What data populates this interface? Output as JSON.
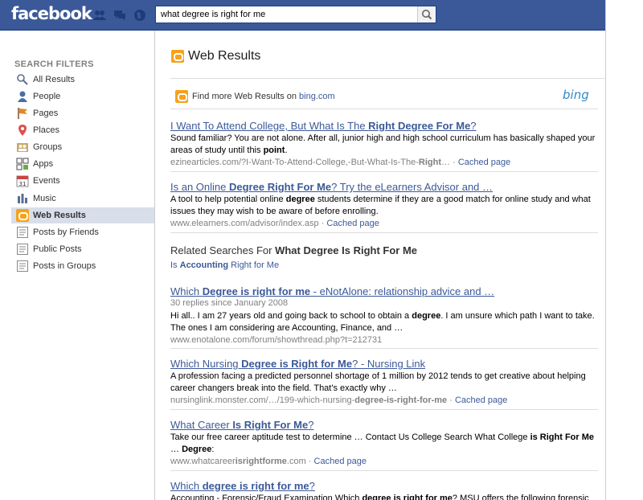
{
  "header": {
    "logo": "facebook",
    "search_value": "what degree is right for me"
  },
  "sidebar": {
    "title": "SEARCH FILTERS",
    "items": [
      {
        "label": "All Results",
        "icon": "magnifier-icon"
      },
      {
        "label": "People",
        "icon": "person-icon"
      },
      {
        "label": "Pages",
        "icon": "flag-icon"
      },
      {
        "label": "Places",
        "icon": "map-pin-icon"
      },
      {
        "label": "Groups",
        "icon": "groups-icon"
      },
      {
        "label": "Apps",
        "icon": "puzzle-icon"
      },
      {
        "label": "Events",
        "icon": "calendar-icon"
      },
      {
        "label": "Music",
        "icon": "music-icon"
      },
      {
        "label": "Web Results",
        "icon": "bing-icon",
        "active": true
      },
      {
        "label": "Posts by Friends",
        "icon": "posts-icon"
      },
      {
        "label": "Public Posts",
        "icon": "posts-icon"
      },
      {
        "label": "Posts in Groups",
        "icon": "posts-icon"
      }
    ]
  },
  "main": {
    "heading": "Web Results",
    "find_more_prefix": "Find more Web Results on",
    "find_more_link": "bing.com",
    "bing_logo": "bing",
    "cached_label": "Cached page",
    "related_prefix": "Related Searches For",
    "related_query": "What Degree Is Right For Me",
    "related_items": [
      {
        "pre": "Is ",
        "bold": "Accounting",
        "post": " Right for Me"
      }
    ]
  },
  "results": [
    {
      "title_parts": [
        [
          "I Want To Attend College, But What Is The ",
          false
        ],
        [
          "Right Degree For Me",
          true
        ],
        [
          "?",
          false
        ]
      ],
      "meta": "",
      "snippet_parts": [
        [
          "Sound familiar? You are not alone. After all, junior high and high school curriculum has basically shaped your areas of study until this ",
          false
        ],
        [
          "point",
          true
        ],
        [
          ".",
          false
        ]
      ],
      "url_parts": [
        [
          "ezinearticles.com/?I-Want-To-Attend-College,-But-What-Is-The-",
          false
        ],
        [
          "Right",
          true
        ],
        [
          "…",
          false
        ]
      ],
      "cached": true
    },
    {
      "title_parts": [
        [
          "Is an Online ",
          false
        ],
        [
          "Degree Right For Me",
          true
        ],
        [
          "? Try the eLearners Advisor and …",
          false
        ]
      ],
      "meta": "",
      "snippet_parts": [
        [
          "A tool to help potential online ",
          false
        ],
        [
          "degree",
          true
        ],
        [
          " students determine if they are a good match for online study and what issues they may wish to be aware of before enrolling.",
          false
        ]
      ],
      "url_parts": [
        [
          "www.elearners.com/advisor/index.asp",
          false
        ]
      ],
      "cached": true
    },
    {
      "title_parts": [
        [
          "Which ",
          false
        ],
        [
          "Degree is right for me",
          true
        ],
        [
          " - eNotAlone: relationship advice and …",
          false
        ]
      ],
      "meta": "30 replies since January 2008",
      "snippet_parts": [
        [
          "Hi all.. I am 27 years old and going back to school to obtain a ",
          false
        ],
        [
          "degree",
          true
        ],
        [
          ". I am unsure which path I want to take. The ones I am considering are Accounting, Finance, and …",
          false
        ]
      ],
      "url_parts": [
        [
          "www.enotalone.com/forum/showthread.php?t=212731",
          false
        ]
      ],
      "cached": false
    },
    {
      "title_parts": [
        [
          "Which Nursing ",
          false
        ],
        [
          "Degree is Right for Me",
          true
        ],
        [
          "? - Nursing Link",
          false
        ]
      ],
      "meta": "",
      "snippet_parts": [
        [
          "A profession facing a predicted personnel shortage of 1 million by 2012 tends to get creative about helping career changers break into the field. That's exactly why …",
          false
        ]
      ],
      "url_parts": [
        [
          "nursinglink.monster.com/…/199-which-nursing-",
          false
        ],
        [
          "degree-is-right-for-me",
          true
        ]
      ],
      "cached": true
    },
    {
      "title_parts": [
        [
          "What Career ",
          false
        ],
        [
          "Is Right For Me",
          true
        ],
        [
          "?",
          false
        ]
      ],
      "meta": "",
      "snippet_parts": [
        [
          "Take our free career aptitude test to determine … Contact Us College Search What College ",
          false
        ],
        [
          "is Right For Me",
          true
        ],
        [
          " … ",
          false
        ],
        [
          "Degree",
          true
        ],
        [
          ":",
          false
        ]
      ],
      "url_parts": [
        [
          "www.whatcareer",
          false
        ],
        [
          "isrightforme",
          true
        ],
        [
          ".com",
          false
        ]
      ],
      "cached": true
    },
    {
      "title_parts": [
        [
          "Which ",
          false
        ],
        [
          "degree is right for me",
          true
        ],
        [
          "?",
          false
        ]
      ],
      "meta": "",
      "snippet_parts": [
        [
          "Accounting - Forensic/Fraud Examination Which ",
          false
        ],
        [
          "degree is right for me",
          true
        ],
        [
          "? MSU offers the following forensic",
          false
        ]
      ],
      "url_parts": [],
      "cached": false
    }
  ]
}
